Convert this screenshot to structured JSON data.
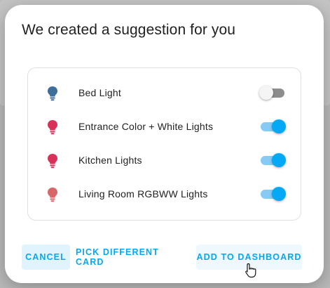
{
  "dialog": {
    "title": "We created a suggestion for you"
  },
  "entities": [
    {
      "name": "Bed Light",
      "icon": "lightbulb-icon",
      "icon_color": "#3e6f9a",
      "state": "off"
    },
    {
      "name": "Entrance Color + White Lights",
      "icon": "lightbulb-icon",
      "icon_color": "#d9315a",
      "state": "on"
    },
    {
      "name": "Kitchen Lights",
      "icon": "lightbulb-icon",
      "icon_color": "#d9315a",
      "state": "on"
    },
    {
      "name": "Living Room RGBWW Lights",
      "icon": "lightbulb-icon",
      "icon_color": "#d86868",
      "state": "on"
    }
  ],
  "actions": {
    "cancel_label": "CANCEL",
    "pick_label": "PICK DIFFERENT CARD",
    "add_label": "ADD TO DASHBOARD"
  },
  "colors": {
    "accent": "#03a9f4"
  }
}
